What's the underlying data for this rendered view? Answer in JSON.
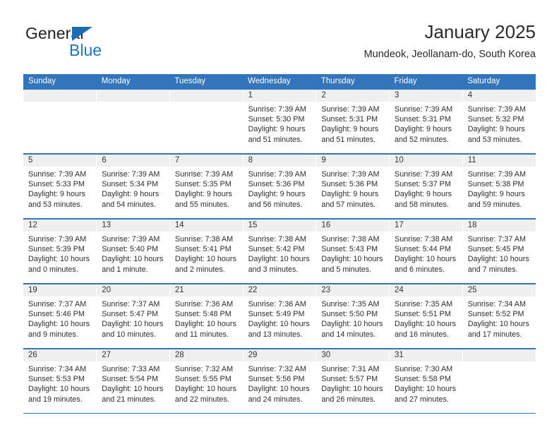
{
  "logo": {
    "word1": "General",
    "word2": "Blue",
    "triangle_color": "#1b6cb5",
    "blue_color": "#1b76c4"
  },
  "header": {
    "title": "January 2025",
    "location": "Mundeok, Jeollanam-do, South Korea"
  },
  "theme": {
    "header_bg": "#3275ba",
    "daynum_bg": "#f0f0f0",
    "grid_line": "#3275ba",
    "text": "#2e2e2e"
  },
  "weekdays": [
    "Sunday",
    "Monday",
    "Tuesday",
    "Wednesday",
    "Thursday",
    "Friday",
    "Saturday"
  ],
  "labels": {
    "sunrise": "Sunrise:",
    "sunset": "Sunset:",
    "daylight": "Daylight:"
  },
  "weeks": [
    [
      {
        "day": "",
        "empty": true
      },
      {
        "day": "",
        "empty": true
      },
      {
        "day": "",
        "empty": true
      },
      {
        "day": "1",
        "sunrise": "Sunrise: 7:39 AM",
        "sunset": "Sunset: 5:30 PM",
        "daylight": "Daylight: 9 hours and 51 minutes."
      },
      {
        "day": "2",
        "sunrise": "Sunrise: 7:39 AM",
        "sunset": "Sunset: 5:31 PM",
        "daylight": "Daylight: 9 hours and 51 minutes."
      },
      {
        "day": "3",
        "sunrise": "Sunrise: 7:39 AM",
        "sunset": "Sunset: 5:31 PM",
        "daylight": "Daylight: 9 hours and 52 minutes."
      },
      {
        "day": "4",
        "sunrise": "Sunrise: 7:39 AM",
        "sunset": "Sunset: 5:32 PM",
        "daylight": "Daylight: 9 hours and 53 minutes."
      }
    ],
    [
      {
        "day": "5",
        "sunrise": "Sunrise: 7:39 AM",
        "sunset": "Sunset: 5:33 PM",
        "daylight": "Daylight: 9 hours and 53 minutes."
      },
      {
        "day": "6",
        "sunrise": "Sunrise: 7:39 AM",
        "sunset": "Sunset: 5:34 PM",
        "daylight": "Daylight: 9 hours and 54 minutes."
      },
      {
        "day": "7",
        "sunrise": "Sunrise: 7:39 AM",
        "sunset": "Sunset: 5:35 PM",
        "daylight": "Daylight: 9 hours and 55 minutes."
      },
      {
        "day": "8",
        "sunrise": "Sunrise: 7:39 AM",
        "sunset": "Sunset: 5:36 PM",
        "daylight": "Daylight: 9 hours and 56 minutes."
      },
      {
        "day": "9",
        "sunrise": "Sunrise: 7:39 AM",
        "sunset": "Sunset: 5:36 PM",
        "daylight": "Daylight: 9 hours and 57 minutes."
      },
      {
        "day": "10",
        "sunrise": "Sunrise: 7:39 AM",
        "sunset": "Sunset: 5:37 PM",
        "daylight": "Daylight: 9 hours and 58 minutes."
      },
      {
        "day": "11",
        "sunrise": "Sunrise: 7:39 AM",
        "sunset": "Sunset: 5:38 PM",
        "daylight": "Daylight: 9 hours and 59 minutes."
      }
    ],
    [
      {
        "day": "12",
        "sunrise": "Sunrise: 7:39 AM",
        "sunset": "Sunset: 5:39 PM",
        "daylight": "Daylight: 10 hours and 0 minutes."
      },
      {
        "day": "13",
        "sunrise": "Sunrise: 7:39 AM",
        "sunset": "Sunset: 5:40 PM",
        "daylight": "Daylight: 10 hours and 1 minute."
      },
      {
        "day": "14",
        "sunrise": "Sunrise: 7:38 AM",
        "sunset": "Sunset: 5:41 PM",
        "daylight": "Daylight: 10 hours and 2 minutes."
      },
      {
        "day": "15",
        "sunrise": "Sunrise: 7:38 AM",
        "sunset": "Sunset: 5:42 PM",
        "daylight": "Daylight: 10 hours and 3 minutes."
      },
      {
        "day": "16",
        "sunrise": "Sunrise: 7:38 AM",
        "sunset": "Sunset: 5:43 PM",
        "daylight": "Daylight: 10 hours and 5 minutes."
      },
      {
        "day": "17",
        "sunrise": "Sunrise: 7:38 AM",
        "sunset": "Sunset: 5:44 PM",
        "daylight": "Daylight: 10 hours and 6 minutes."
      },
      {
        "day": "18",
        "sunrise": "Sunrise: 7:37 AM",
        "sunset": "Sunset: 5:45 PM",
        "daylight": "Daylight: 10 hours and 7 minutes."
      }
    ],
    [
      {
        "day": "19",
        "sunrise": "Sunrise: 7:37 AM",
        "sunset": "Sunset: 5:46 PM",
        "daylight": "Daylight: 10 hours and 9 minutes."
      },
      {
        "day": "20",
        "sunrise": "Sunrise: 7:37 AM",
        "sunset": "Sunset: 5:47 PM",
        "daylight": "Daylight: 10 hours and 10 minutes."
      },
      {
        "day": "21",
        "sunrise": "Sunrise: 7:36 AM",
        "sunset": "Sunset: 5:48 PM",
        "daylight": "Daylight: 10 hours and 11 minutes."
      },
      {
        "day": "22",
        "sunrise": "Sunrise: 7:36 AM",
        "sunset": "Sunset: 5:49 PM",
        "daylight": "Daylight: 10 hours and 13 minutes."
      },
      {
        "day": "23",
        "sunrise": "Sunrise: 7:35 AM",
        "sunset": "Sunset: 5:50 PM",
        "daylight": "Daylight: 10 hours and 14 minutes."
      },
      {
        "day": "24",
        "sunrise": "Sunrise: 7:35 AM",
        "sunset": "Sunset: 5:51 PM",
        "daylight": "Daylight: 10 hours and 16 minutes."
      },
      {
        "day": "25",
        "sunrise": "Sunrise: 7:34 AM",
        "sunset": "Sunset: 5:52 PM",
        "daylight": "Daylight: 10 hours and 17 minutes."
      }
    ],
    [
      {
        "day": "26",
        "sunrise": "Sunrise: 7:34 AM",
        "sunset": "Sunset: 5:53 PM",
        "daylight": "Daylight: 10 hours and 19 minutes."
      },
      {
        "day": "27",
        "sunrise": "Sunrise: 7:33 AM",
        "sunset": "Sunset: 5:54 PM",
        "daylight": "Daylight: 10 hours and 21 minutes."
      },
      {
        "day": "28",
        "sunrise": "Sunrise: 7:32 AM",
        "sunset": "Sunset: 5:55 PM",
        "daylight": "Daylight: 10 hours and 22 minutes."
      },
      {
        "day": "29",
        "sunrise": "Sunrise: 7:32 AM",
        "sunset": "Sunset: 5:56 PM",
        "daylight": "Daylight: 10 hours and 24 minutes."
      },
      {
        "day": "30",
        "sunrise": "Sunrise: 7:31 AM",
        "sunset": "Sunset: 5:57 PM",
        "daylight": "Daylight: 10 hours and 26 minutes."
      },
      {
        "day": "31",
        "sunrise": "Sunrise: 7:30 AM",
        "sunset": "Sunset: 5:58 PM",
        "daylight": "Daylight: 10 hours and 27 minutes."
      },
      {
        "day": "",
        "empty": true
      }
    ]
  ]
}
